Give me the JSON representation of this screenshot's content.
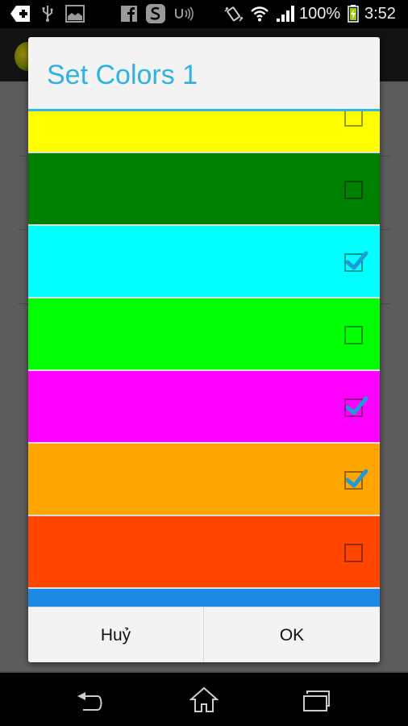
{
  "status_bar": {
    "left_icons": [
      "add-notification-icon",
      "usb-icon",
      "gallery-icon",
      "facebook-icon",
      "skype-icon",
      "nfc-icon"
    ],
    "right_icons": [
      "vibrate-icon",
      "wifi-icon",
      "signal-icon",
      "battery-charging-icon"
    ],
    "battery_percent": "100%",
    "time": "3:52"
  },
  "dialog": {
    "title": "Set Colors 1",
    "title_color": "#33b5e5",
    "colors": [
      {
        "name": "yellow",
        "hex": "#ffff00",
        "checked": false
      },
      {
        "name": "green",
        "hex": "#008000",
        "checked": false
      },
      {
        "name": "cyan",
        "hex": "#00ffff",
        "checked": true
      },
      {
        "name": "lime",
        "hex": "#00ff00",
        "checked": false
      },
      {
        "name": "magenta",
        "hex": "#ff00ff",
        "checked": true
      },
      {
        "name": "orange",
        "hex": "#ffa500",
        "checked": true
      },
      {
        "name": "orangered",
        "hex": "#ff4500",
        "checked": false
      },
      {
        "name": "dodgerblue",
        "hex": "#1e88e5",
        "checked": false
      }
    ],
    "buttons": {
      "cancel_label": "Huỷ",
      "ok_label": "OK"
    }
  },
  "nav_bar": {
    "buttons": [
      "back",
      "home",
      "recent-apps"
    ]
  }
}
